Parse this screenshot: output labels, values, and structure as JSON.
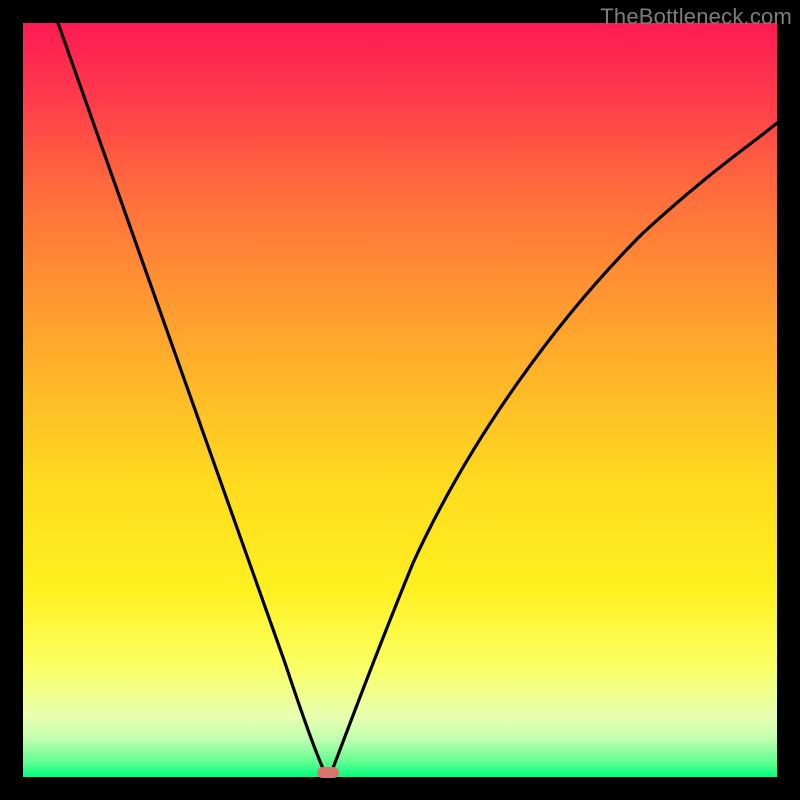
{
  "watermark": "TheBottleneck.com",
  "colors": {
    "frame": "#000000",
    "curve": "#000000",
    "marker": "#d8766e",
    "gradient_top": "#ff1a53",
    "gradient_bottom": "#00ff80"
  },
  "chart_data": {
    "type": "line",
    "title": "",
    "xlabel": "",
    "ylabel": "",
    "xlim": [
      0,
      100
    ],
    "ylim": [
      0,
      100
    ],
    "grid": false,
    "annotations": [
      "TheBottleneck.com"
    ],
    "marker": {
      "x": 40,
      "y": 0,
      "shape": "rounded-rect"
    },
    "series": [
      {
        "name": "left-branch",
        "x": [
          5,
          10,
          15,
          20,
          25,
          30,
          33,
          36,
          38,
          39,
          40
        ],
        "values": [
          100,
          87,
          73,
          59,
          45,
          30,
          20,
          11,
          5,
          2,
          0
        ]
      },
      {
        "name": "right-branch",
        "x": [
          40,
          42,
          45,
          48,
          52,
          58,
          65,
          72,
          80,
          90,
          100
        ],
        "values": [
          0,
          7,
          18,
          28,
          38,
          49,
          58,
          64,
          70,
          76,
          80
        ]
      }
    ]
  }
}
